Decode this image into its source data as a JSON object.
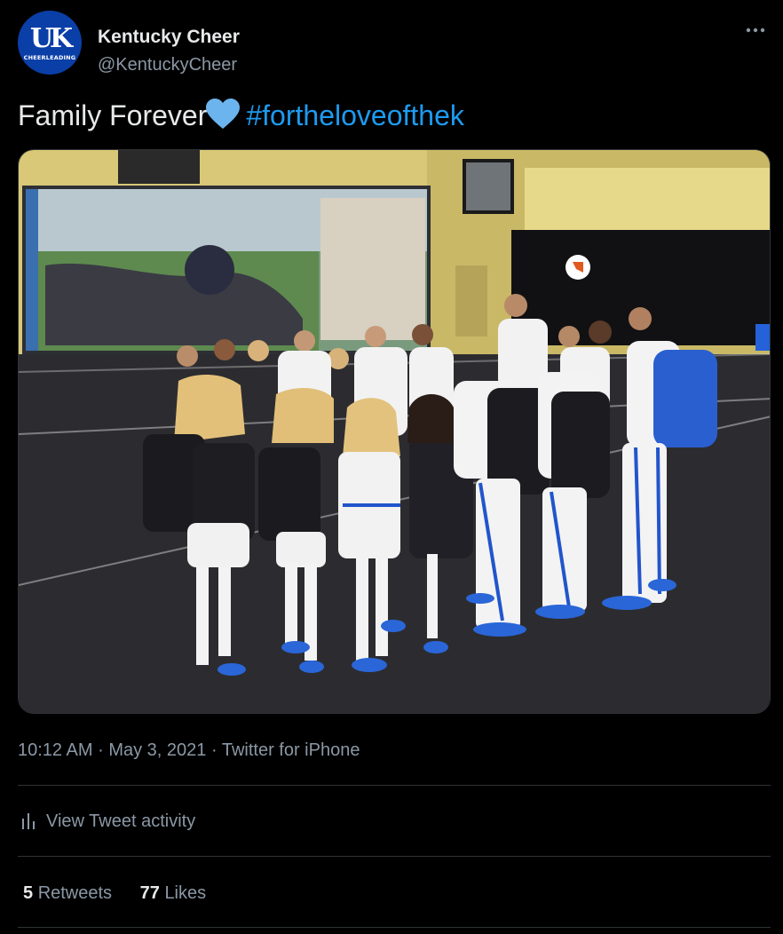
{
  "colors": {
    "background": "#000000",
    "text_primary": "#e7e9ea",
    "text_secondary": "#8b98a5",
    "link": "#1d9bf0",
    "heart": "#6cb4ee",
    "avatar_bg": "#0a3fa8",
    "divider": "#2f3336"
  },
  "author": {
    "avatar_text": "UK",
    "avatar_subtext": "CHEERLEADING",
    "display_name": "Kentucky Cheer",
    "handle": "@KentuckyCheer",
    "more_icon": "more-horizontal-icon"
  },
  "tweet": {
    "text": "Family Forever",
    "emoji_icon": "blue-heart-icon",
    "hashtag": "#fortheloveofthek"
  },
  "photo": {
    "description_icon": "team-huddle-photo"
  },
  "meta": {
    "time": "10:12 AM",
    "date": "May 3, 2021",
    "source": "Twitter for iPhone",
    "separator": "·"
  },
  "activity": {
    "icon": "bar-chart-icon",
    "label": "View Tweet activity"
  },
  "stats": {
    "retweets_count": "5",
    "retweets_label": "Retweets",
    "likes_count": "77",
    "likes_label": "Likes"
  }
}
